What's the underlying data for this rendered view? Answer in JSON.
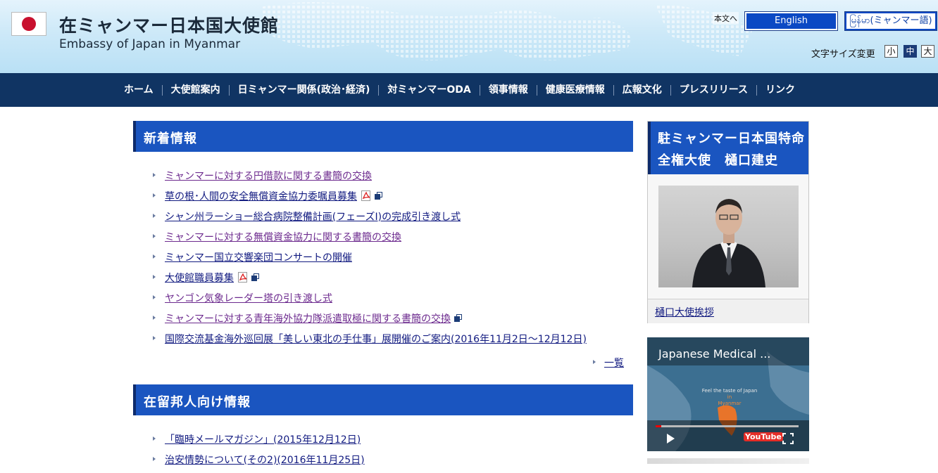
{
  "header": {
    "title_ja": "在ミャンマー日本国大使館",
    "title_en": "Embassy of Japan in Myanmar",
    "skip_link": "本文へ",
    "lang_english": "English",
    "lang_myanmar": "မြန်မာ(ミャンマー語)",
    "font_size_label": "文字サイズ変更",
    "font_size_small": "小",
    "font_size_medium": "中",
    "font_size_large": "大"
  },
  "nav": {
    "items": [
      {
        "label": "ホーム"
      },
      {
        "label": "大使館案内"
      },
      {
        "label": "日ミャンマー関係(政治･経済)"
      },
      {
        "label": "対ミャンマーODA"
      },
      {
        "label": "領事情報"
      },
      {
        "label": "健康医療情報"
      },
      {
        "label": "広報文化"
      },
      {
        "label": "プレスリリース"
      },
      {
        "label": "リンク"
      }
    ]
  },
  "news": {
    "heading": "新着情報",
    "items": [
      {
        "text": "ミャンマーに対する円借款に関する書簡の交換"
      },
      {
        "text": "草の根･人間の安全無償資金協力委嘱員募集"
      },
      {
        "text": "シャン州ラーショー総合病院整備計画(フェーズI)の完成引き渡し式"
      },
      {
        "text": "ミャンマーに対する無償資金協力に関する書簡の交換"
      },
      {
        "text": "ミャンマー国立交響楽団コンサートの開催"
      },
      {
        "text": "大使館職員募集"
      },
      {
        "text": "ヤンゴン気象レーダー塔の引き渡し式"
      },
      {
        "text": "ミャンマーに対する青年海外協力隊派遣取極に関する書簡の交換"
      },
      {
        "text": "国際交流基金海外巡回展「美しい東北の手仕事」展開催のご案内(2016年11月2日～12月12日)"
      }
    ],
    "more_label": "一覧"
  },
  "residents": {
    "heading": "在留邦人向け情報",
    "items": [
      {
        "text": "「臨時メールマガジン」(2015年12月12日)"
      },
      {
        "text": "治安情勢について(その2)(2016年11月25日)"
      }
    ]
  },
  "sidebar": {
    "ambassador_heading": "駐ミャンマー日本国特命全権大使　樋口建史",
    "ambassador_greeting_link": "樋口大使挨拶",
    "video_title": "Japanese Medical ...",
    "video_caption_line1": "Feel the taste of Japan",
    "video_caption_line2": "in",
    "video_caption_line3": "Myanmar",
    "video_logo": "YouTube"
  },
  "colors": {
    "nav_bg": "#103463",
    "heading_bg": "#1a55c0",
    "link": "#111a80",
    "visited_link": "#6c2a8e"
  }
}
